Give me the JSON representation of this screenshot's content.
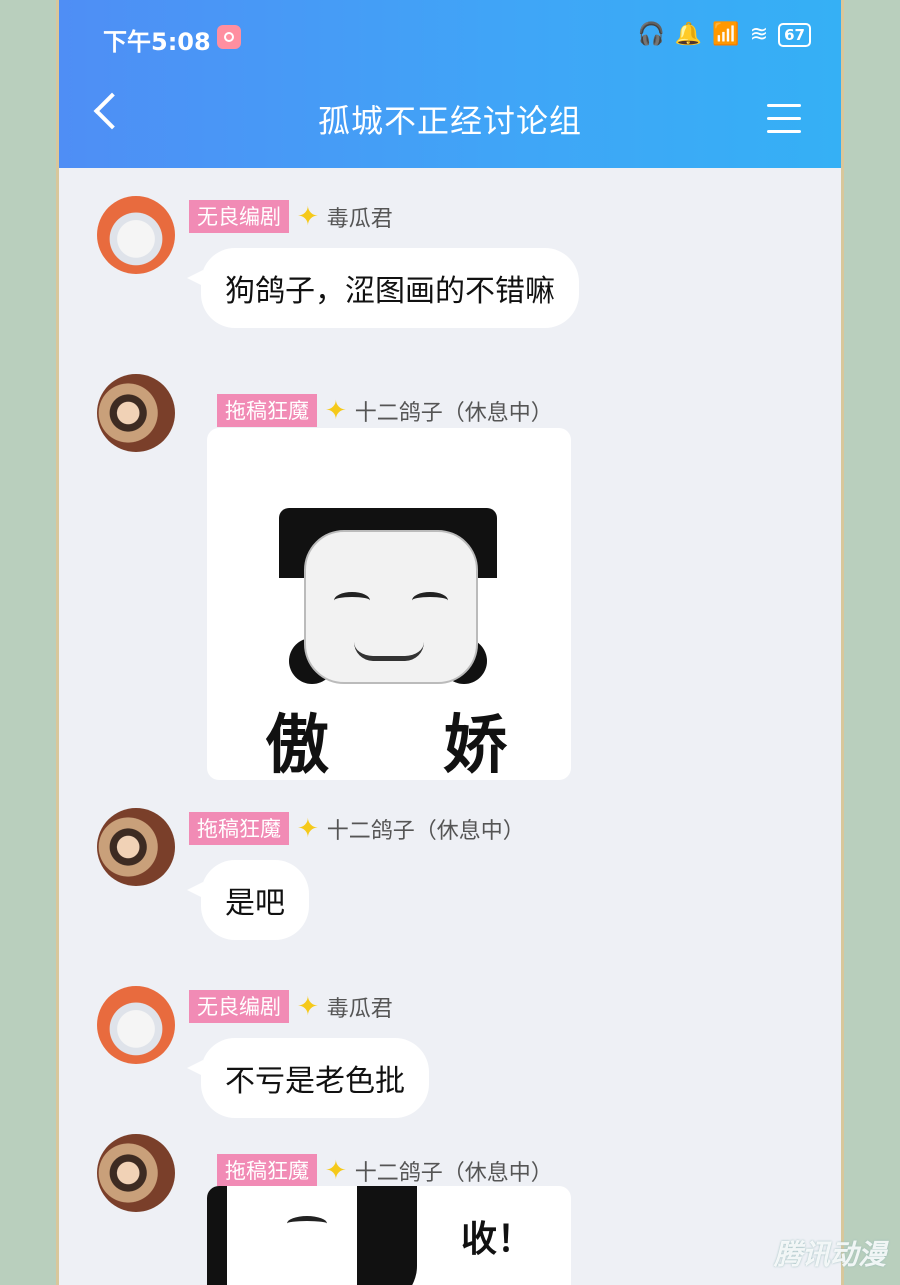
{
  "status": {
    "time": "下午5:08",
    "battery": "67"
  },
  "header": {
    "title": "孤城不正经讨论组"
  },
  "messages": [
    {
      "tag": "无良编剧",
      "name": "毒瓜君",
      "text": "狗鸽子，涩图画的不错嘛"
    },
    {
      "tag": "拖稿狂魔",
      "name": "十二鸽子（休息中）",
      "sticker_caption_left": "傲",
      "sticker_caption_right": "娇"
    },
    {
      "tag": "拖稿狂魔",
      "name": "十二鸽子（休息中）",
      "text": "是吧"
    },
    {
      "tag": "无良编剧",
      "name": "毒瓜君",
      "text": "不亏是老色批"
    },
    {
      "tag": "拖稿狂魔",
      "name": "十二鸽子（休息中）",
      "sticker_caption": "收！"
    }
  ],
  "watermark": "腾讯动漫",
  "colors": {
    "header_start": "#4f8ef5",
    "header_end": "#35b0f5",
    "tag_pink": "#f18bb5",
    "star": "#f5c91a",
    "chat_bg": "#eef0f5"
  }
}
